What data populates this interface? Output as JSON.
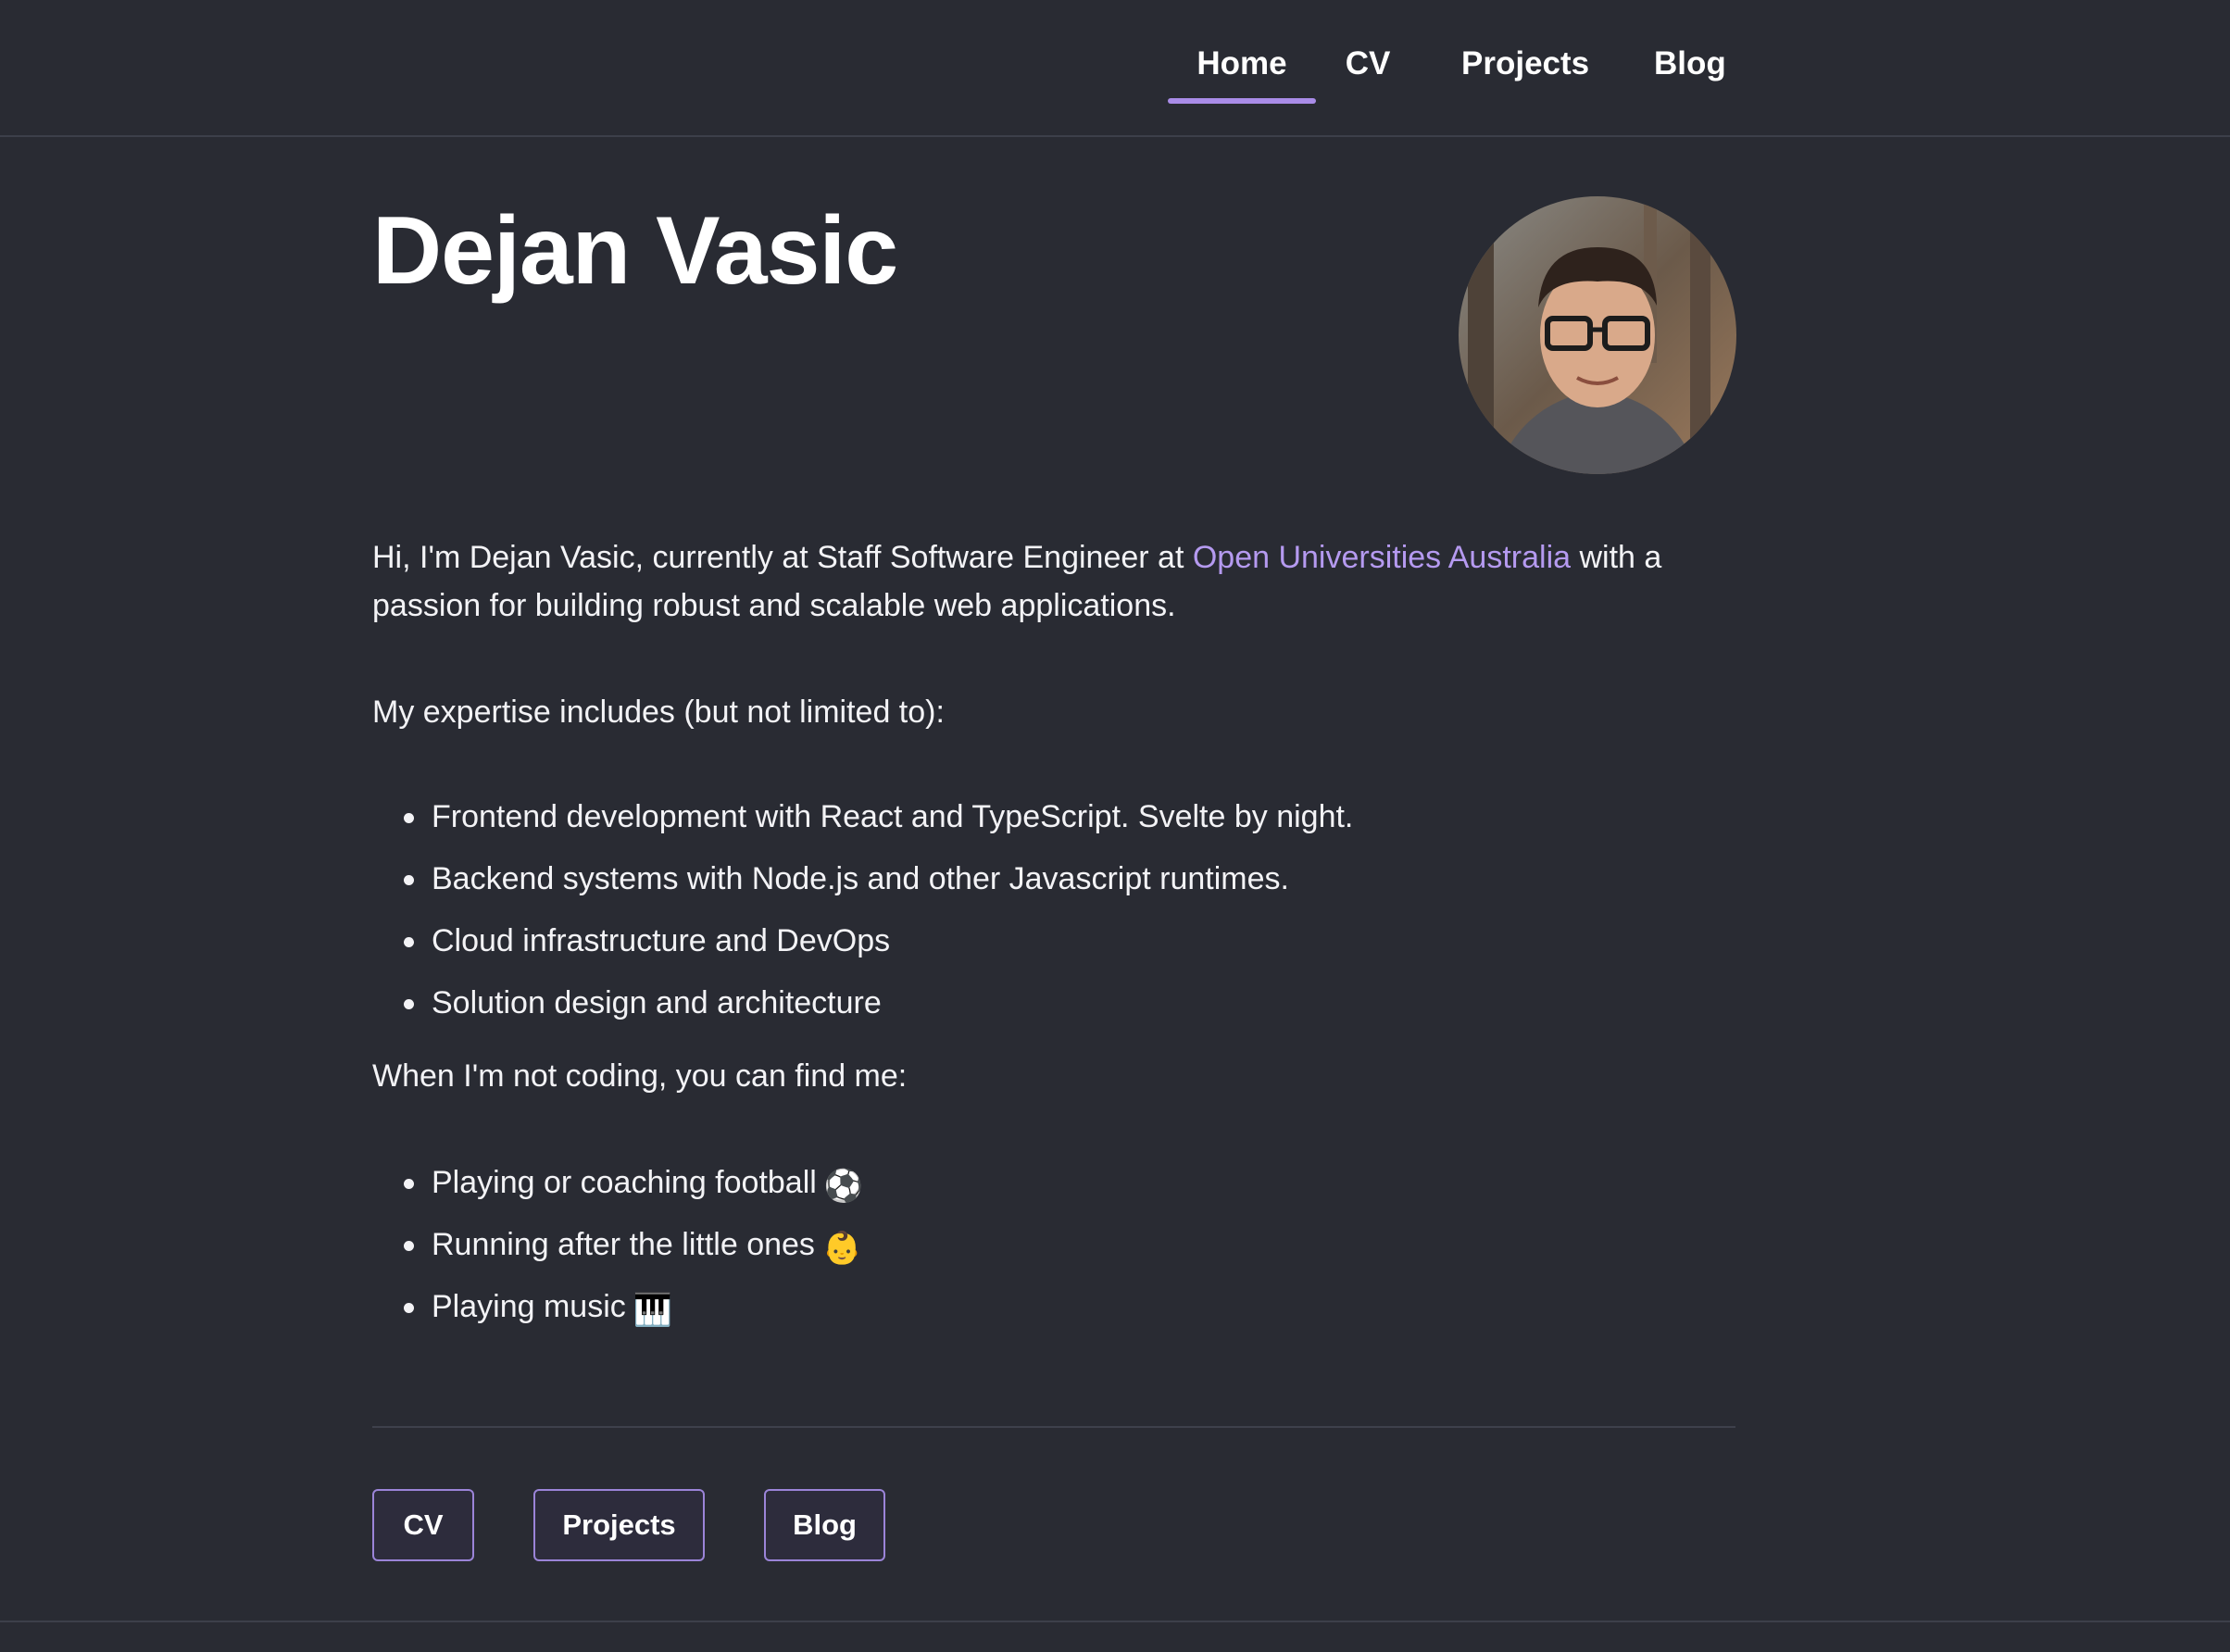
{
  "nav": {
    "items": [
      {
        "label": "Home",
        "active": true
      },
      {
        "label": "CV",
        "active": false
      },
      {
        "label": "Projects",
        "active": false
      },
      {
        "label": "Blog",
        "active": false
      }
    ]
  },
  "hero": {
    "name": "Dejan Vasic",
    "avatar_icon": "profile-photo"
  },
  "intro": {
    "before_link": "Hi, I'm Dejan Vasic, currently at Staff Software Engineer at ",
    "link_text": "Open Universities Australia",
    "after_link": " with a passion for building robust and scalable web applications."
  },
  "expertise": {
    "heading": "My expertise includes (but not limited to):",
    "items": [
      "Frontend development with React and TypeScript. Svelte by night.",
      "Backend systems with Node.js and other Javascript runtimes.",
      "Cloud infrastructure and DevOps",
      "Solution design and architecture"
    ]
  },
  "hobbies": {
    "heading": "When I'm not coding, you can find me:",
    "items": [
      {
        "text": "Playing or coaching football",
        "emoji": "⚽"
      },
      {
        "text": "Running after the little ones",
        "emoji": "👶"
      },
      {
        "text": "Playing music",
        "emoji": "🎹"
      }
    ]
  },
  "footer_buttons": [
    "CV",
    "Projects",
    "Blog"
  ],
  "colors": {
    "background": "#292b33",
    "accent": "#a98ce8",
    "link": "#b59af0",
    "text": "#f3f3f6"
  }
}
